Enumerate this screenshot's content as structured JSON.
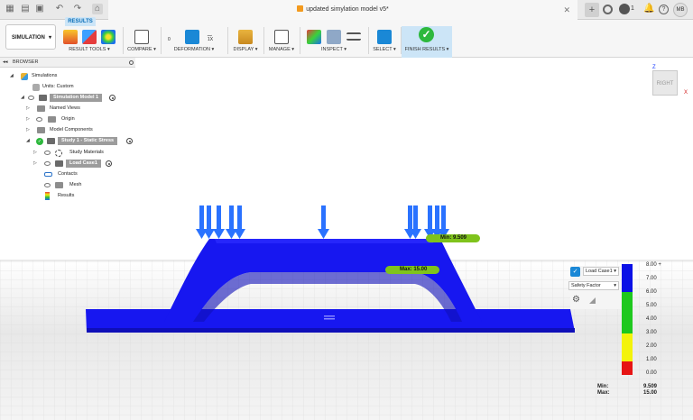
{
  "window": {
    "document_title": "updated simylation model v5*",
    "jobs_count": "1",
    "user_initials": "MB"
  },
  "ribbon": {
    "active_tab": "RESULTS",
    "workspace_label": "SIMULATION",
    "groups": {
      "result_tools": "RESULT TOOLS",
      "compare": "COMPARE",
      "deformation": "DEFORMATION",
      "display": "DISPLAY",
      "manage": "MANAGE",
      "inspect": "INSPECT",
      "select": "SELECT",
      "finish_results": "FINISH RESULTS"
    },
    "deformation_values": {
      "left": "0",
      "right": "1X"
    }
  },
  "browser": {
    "title": "BROWSER",
    "items": [
      {
        "label": "Simulations"
      },
      {
        "label": "Units: Custom"
      },
      {
        "label": "Simulation Model 1"
      },
      {
        "label": "Named Views"
      },
      {
        "label": "Origin"
      },
      {
        "label": "Model Components"
      },
      {
        "label": "Study 1 - Static Stress"
      },
      {
        "label": "Study Materials"
      },
      {
        "label": "Load Case1"
      },
      {
        "label": "Contacts"
      },
      {
        "label": "Mesh"
      },
      {
        "label": "Results"
      }
    ]
  },
  "viewcube": {
    "face": "RIGHT",
    "axis_z": "Z",
    "axis_x": "X"
  },
  "probes": {
    "min_tag": "Min: 9.509",
    "max_tag": "Max: 15.00"
  },
  "legend": {
    "load_case": "Load Case1",
    "result_type": "Safety Factor",
    "ticks": [
      "8.00 +",
      "7.00",
      "6.00",
      "5.00",
      "4.00",
      "3.00",
      "2.00",
      "1.00",
      "0.00"
    ],
    "min_label": "Min:",
    "min_value": "9.509",
    "max_label": "Max:",
    "max_value": "15.00",
    "colors": {
      "blue": "#0a10e6",
      "green": "#1ec81e",
      "yellow": "#f3f30a",
      "red": "#e61414"
    }
  },
  "colors": {
    "model": "#1717f0",
    "model_dark": "#0f0fb8",
    "arrows": "#2a72ff",
    "probe_tag": "#7fc31c",
    "accent": "#0b6fb8"
  }
}
